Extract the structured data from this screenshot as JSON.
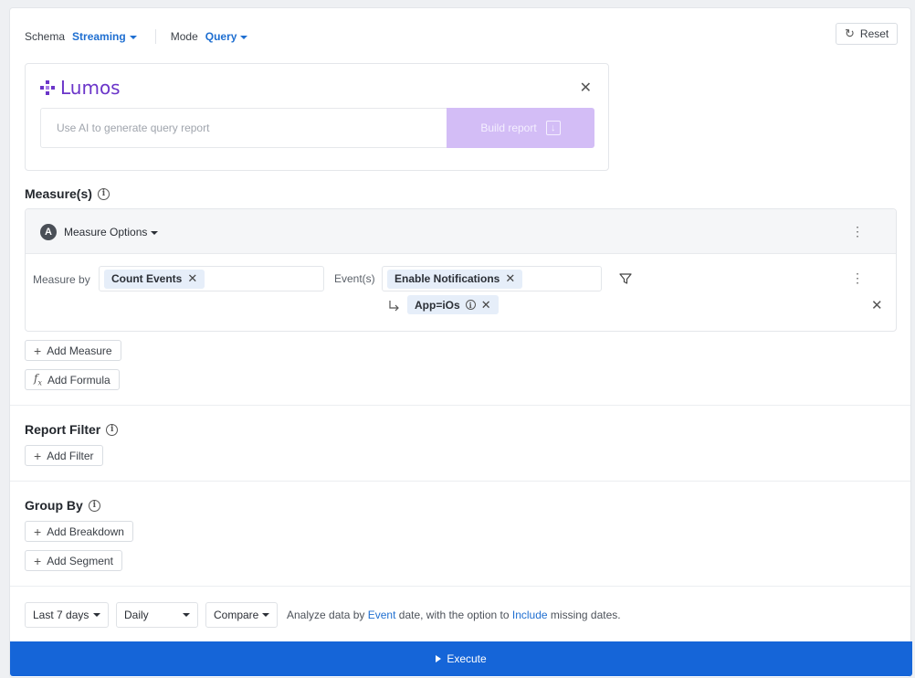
{
  "topbar": {
    "schema_label": "Schema",
    "schema_value": "Streaming",
    "mode_label": "Mode",
    "mode_value": "Query",
    "reset_label": "Reset"
  },
  "lumos": {
    "name": "Lumos",
    "placeholder": "Use AI to generate query report",
    "build_label": "Build report"
  },
  "measures": {
    "title": "Measure(s)",
    "options_badge": "A",
    "options_label": "Measure Options",
    "measure_by_label": "Measure by",
    "measure_chip": "Count Events",
    "events_label": "Event(s)",
    "event_chip": "Enable Notifications",
    "filter_chip": "App=iOs",
    "add_measure_label": "Add Measure",
    "add_formula_label": "Add Formula"
  },
  "report_filter": {
    "title": "Report Filter",
    "add_filter_label": "Add Filter"
  },
  "group_by": {
    "title": "Group By",
    "add_breakdown_label": "Add Breakdown",
    "add_segment_label": "Add Segment"
  },
  "footer": {
    "range": "Last 7 days",
    "granularity": "Daily",
    "compare": "Compare",
    "hint_prefix": "Analyze data by",
    "hint_event": "Event",
    "hint_middle": "date, with the option to",
    "hint_include": "Include",
    "hint_suffix": "missing dates.",
    "execute_label": "Execute"
  },
  "colors": {
    "accent": "#1f6fd1",
    "execute_bg": "#1565d8",
    "lumos_brand": "#6b35c9",
    "build_bg": "#d3bdf6",
    "chip_bg": "#e6eef9"
  }
}
